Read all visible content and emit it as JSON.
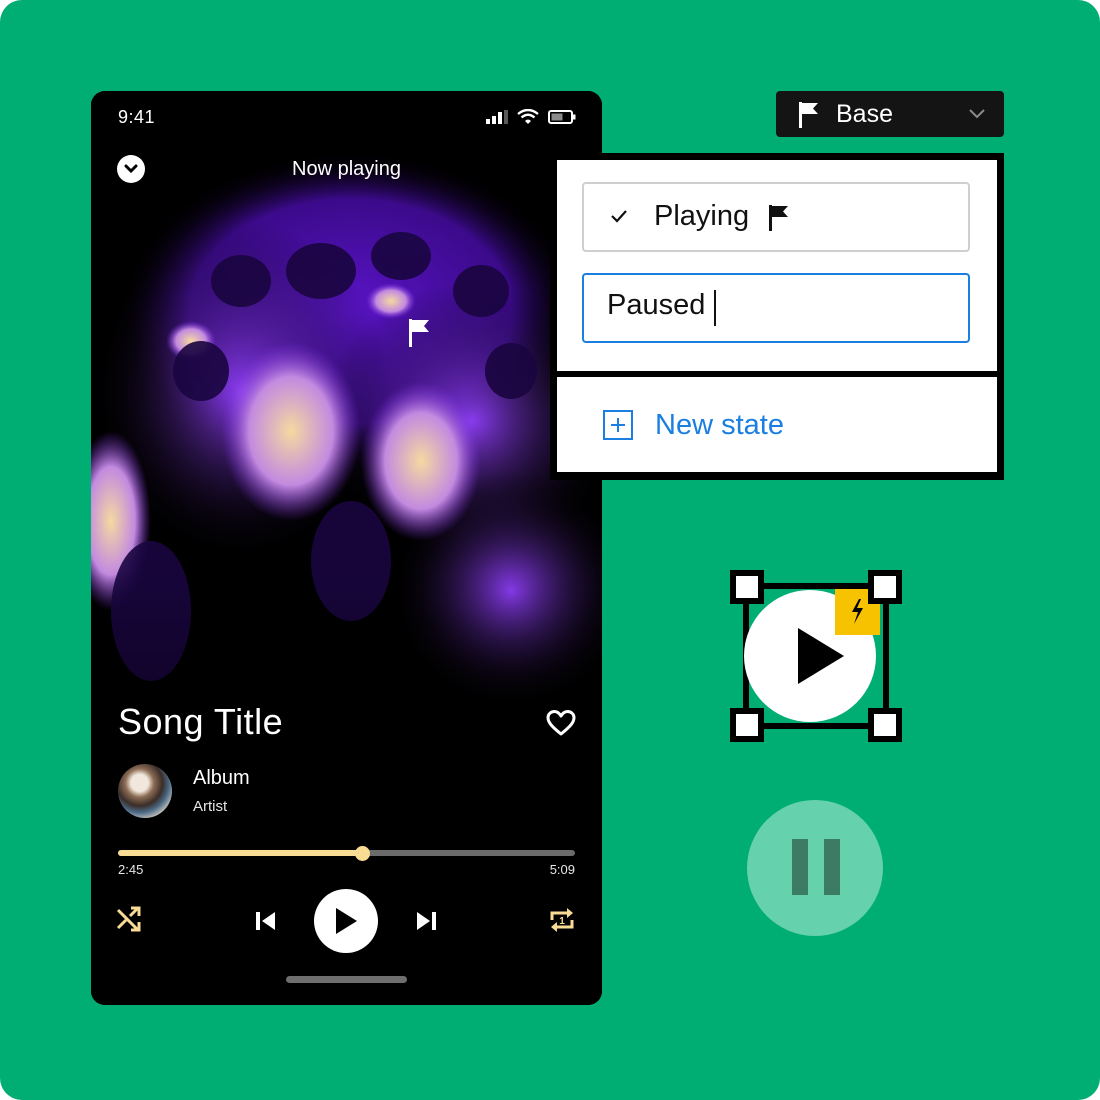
{
  "colors": {
    "background": "#00ae73",
    "accent_gold": "#f8dc93",
    "link_blue": "#1a7fe0",
    "pause_circle": "#66d1ad",
    "pause_bars": "#3c7b64",
    "lightning_badge": "#f7c300"
  },
  "phone": {
    "status_bar": {
      "time": "9:41",
      "icons": [
        "signal-icon",
        "wifi-icon",
        "battery-icon"
      ]
    },
    "header": {
      "collapse_icon": "chevron-down-circle-icon",
      "title": "Now playing"
    },
    "artwork": {
      "description": "purple and cream fluid abstract art",
      "overlay_icon": "flag-icon"
    },
    "track": {
      "title": "Song Title",
      "album": "Album",
      "artist": "Artist",
      "favorite_icon": "heart-outline-icon"
    },
    "progress": {
      "current": "2:45",
      "total": "5:09",
      "fraction": 0.534
    },
    "controls": [
      "shuffle-icon",
      "skip-previous-icon",
      "play-icon",
      "skip-next-icon",
      "repeat-one-icon"
    ]
  },
  "base_dropdown": {
    "icon": "flag-icon",
    "label": "Base",
    "chevron": "chevron-down-icon"
  },
  "states_panel": {
    "states": [
      {
        "label": "Playing",
        "checked": true,
        "flagged": true
      },
      {
        "value": "Paused",
        "placeholder": "",
        "editing": true
      }
    ],
    "new_state_label": "New state"
  },
  "component": {
    "icon": "play-icon",
    "badge_icon": "lightning-icon"
  },
  "pause_button": {
    "icon": "pause-icon"
  }
}
